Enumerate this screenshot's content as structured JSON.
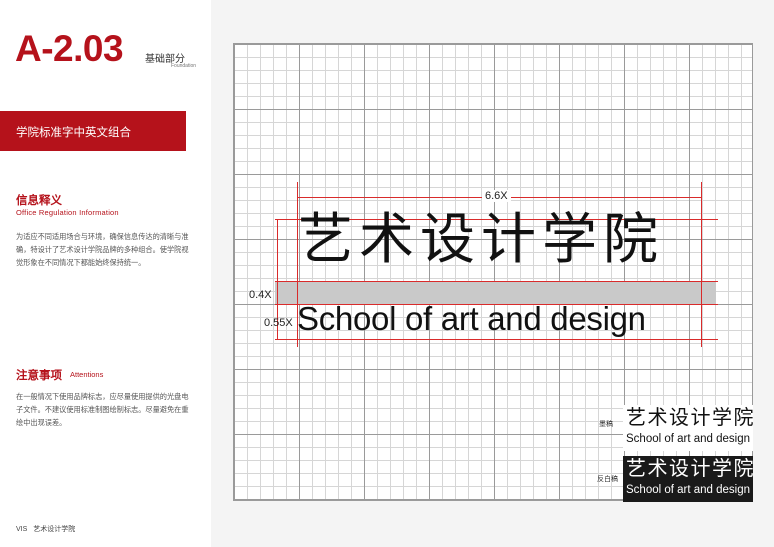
{
  "header": {
    "page_code": "A-2.03",
    "section_cn": "基础部分",
    "section_en": "Foundation"
  },
  "title_bar": {
    "text": "学院标准字中英文组合"
  },
  "info": {
    "heading_cn": "信息释义",
    "heading_en": "Office Regulation Information",
    "body": "为适应不同适用场合与环境，确保信息传达的清晰与准确，特设计了艺术设计学院品牌的多种组合。使学院视觉形象在不同情况下都能始终保持统一。"
  },
  "attentions": {
    "heading_cn": "注意事项",
    "heading_en": "Attentions",
    "body": "在一般情况下使用品牌标志，应尽量使用提供的光盘电子文件。不建议使用标准制图绘制标志。尽量避免在重绘中出现误差。"
  },
  "footer": {
    "vis": "VIS",
    "name": "艺术设计学院"
  },
  "logo": {
    "cn": "艺术设计学院",
    "en": "School of art and design"
  },
  "dimensions": {
    "width": "6.6X",
    "gap": "0.4X",
    "en_height": "0.55X"
  },
  "variants": {
    "ink_label": "墨稿",
    "reverse_label": "反白稿"
  },
  "colors": {
    "brand_red": "#b5121b",
    "guide_red": "#d92b2b",
    "band_gray": "#c9c9c9"
  }
}
